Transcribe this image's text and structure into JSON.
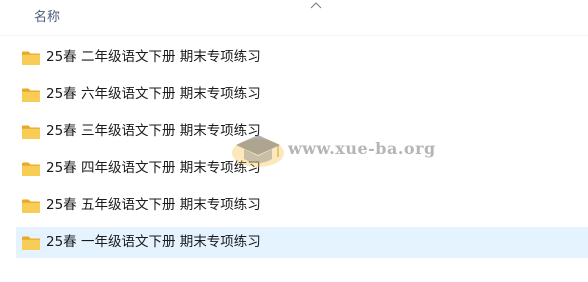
{
  "header": {
    "name_column": "名称",
    "sort_icon": "chevron-up-icon"
  },
  "rows": [
    {
      "label": "25春 二年级语文下册 期末专项练习",
      "icon": "folder-icon",
      "selected": false
    },
    {
      "label": "25春 六年级语文下册 期末专项练习",
      "icon": "folder-icon",
      "selected": false
    },
    {
      "label": "25春 三年级语文下册 期末专项练习",
      "icon": "folder-icon",
      "selected": false
    },
    {
      "label": "25春 四年级语文下册 期末专项练习",
      "icon": "folder-icon",
      "selected": false
    },
    {
      "label": "25春 五年级语文下册 期末专项练习",
      "icon": "folder-icon",
      "selected": false
    },
    {
      "label": "25春 一年级语文下册 期末专项练习",
      "icon": "folder-icon",
      "selected": true
    }
  ],
  "watermark": {
    "text": "www.xue-ba.org",
    "icon": "graduation-cap-logo"
  },
  "colors": {
    "folder": "#f7c948",
    "selection": "#e5f3ff",
    "header_text": "#4c607a"
  }
}
